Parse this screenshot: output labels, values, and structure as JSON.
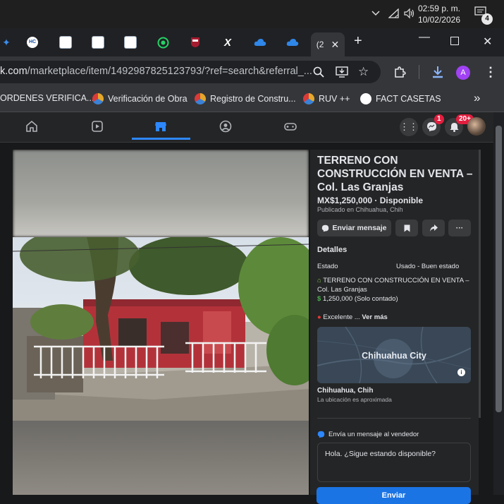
{
  "taskbar": {
    "time": "02:59 p. m.",
    "date": "10/02/2026",
    "notification_count": "4",
    "icons": [
      "chevron-up-icon",
      "wifi-icon",
      "volume-icon",
      "notification-icon"
    ]
  },
  "browser": {
    "tabs": [
      {
        "icon": "star-icon"
      },
      {
        "icon": "hc-icon"
      },
      {
        "icon": "doc-icon"
      },
      {
        "icon": "doc-icon"
      },
      {
        "icon": "doc-icon"
      },
      {
        "icon": "whatsapp-icon"
      },
      {
        "icon": "harvard-icon"
      },
      {
        "icon": "x-icon"
      },
      {
        "icon": "cloud-icon"
      },
      {
        "icon": "cloud-icon"
      },
      {
        "icon": "active-tab-icon",
        "label": "(2"
      }
    ],
    "url_host": "k.com",
    "url_path": "/marketplace/item/1492987825123793/?ref=search&referral_...",
    "profile_initial": "A",
    "bookmarks": [
      {
        "label": "ORDENES VERIFICA...",
        "color": "#8a8d91"
      },
      {
        "label": "Verificación de Obra",
        "color": "#e4a72b"
      },
      {
        "label": "Registro de Constru...",
        "color": "#e4a72b"
      },
      {
        "label": "RUV ++",
        "color": "#e4a72b"
      },
      {
        "label": "FACT CASETAS",
        "color": "#ffffff"
      }
    ],
    "more_bookmarks": "»"
  },
  "facebook": {
    "messenger_badge": "1",
    "notifications_badge": "20+",
    "listing": {
      "title": "TERRENO CON CONSTRUCCIÓN EN VENTA – Col. Las Granjas",
      "price": "MX$1,250,000 · Disponible",
      "published": "Publicado en Chihuahua, Chih",
      "message_button": "Enviar mensaje",
      "details_heading": "Detalles",
      "condition_label": "Estado",
      "condition_value": "Usado - Buen estado",
      "description_line1": "TERRENO CON CONSTRUCCIÓN EN VENTA – Col. Las Granjas",
      "description_line2": "1,250,000 (Solo contado)",
      "description_line3": "Excelente ...",
      "see_more": "Ver más",
      "map_label": "Chihuahua City",
      "location": "Chihuahua, Chih",
      "location_note": "La ubicación es aproximada",
      "seller_heading": "Envía un mensaje al vendedor",
      "message_text": "Hola. ¿Sigue estando disponible?",
      "send_button": "Enviar"
    }
  },
  "colors": {
    "accent": "#2d88ff",
    "send": "#1b74e4",
    "badge": "#e41e3f"
  }
}
